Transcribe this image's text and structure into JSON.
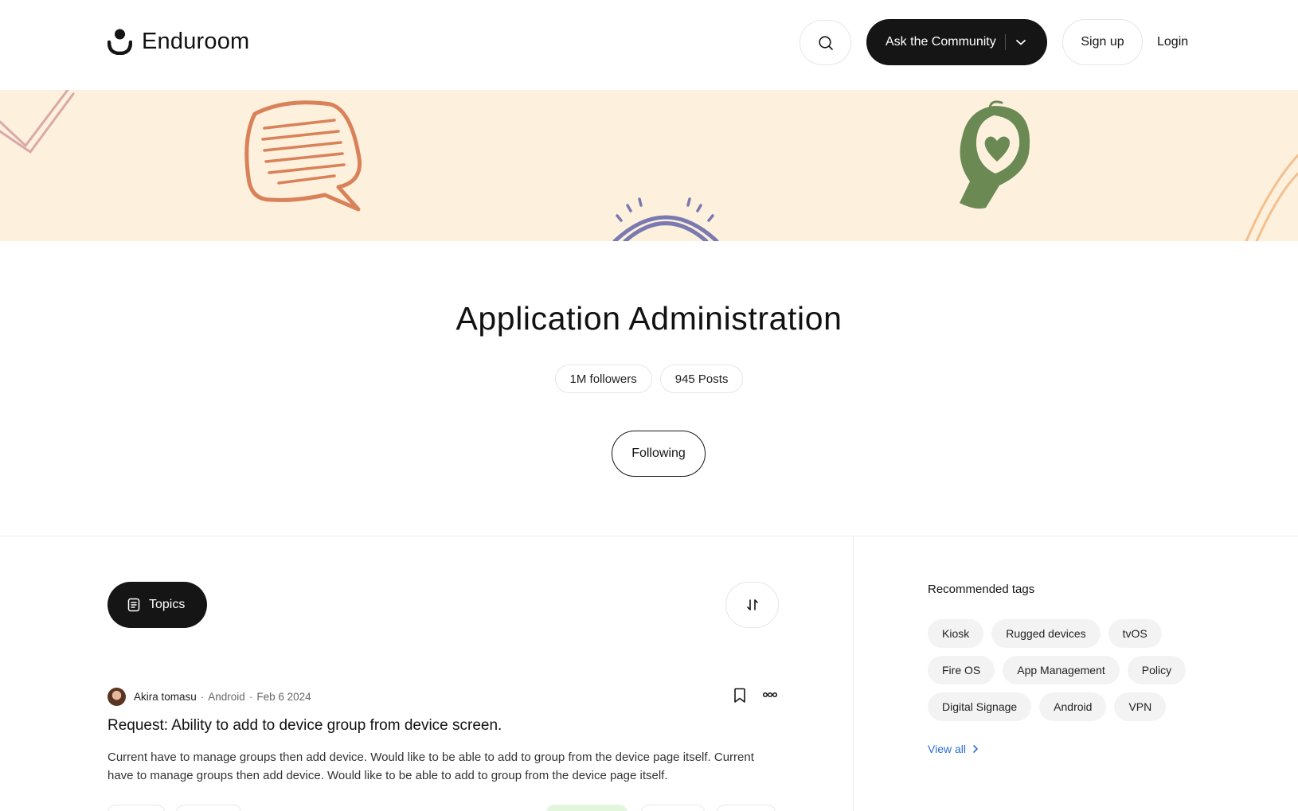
{
  "header": {
    "brand": "Enduroom",
    "ask_label": "Ask the Community",
    "signup_label": "Sign up",
    "login_label": "Login"
  },
  "hero": {
    "title": "Application Administration",
    "followers": "1M followers",
    "posts": "945 Posts",
    "follow_label": "Following"
  },
  "feed": {
    "topics_label": "Topics",
    "post": {
      "author": "Akira tomasu",
      "category": "Android",
      "date": "Feb 6 2024",
      "title": "Request: Ability to add to device group from device screen.",
      "body": "Current have to manage groups then add device. Would like to be able to add to group from the device page itself. Current have to manage groups then add device. Would like to be able to add to group from the device page itself."
    }
  },
  "sidebar": {
    "title": "Recommended tags",
    "tags": [
      "Kiosk",
      "Rugged devices",
      "tvOS",
      "Fire OS",
      "App Management",
      "Policy",
      "Digital Signage",
      "Android",
      "VPN"
    ],
    "view_all": "View all"
  },
  "colors": {
    "banner_bg": "#fdf0dd",
    "speech_bubble": "#d9825a",
    "lightbulb": "#6b8a53",
    "rainbow": "#7a79b0",
    "accent_link": "#2a6fd6",
    "dark_button": "#151515"
  }
}
